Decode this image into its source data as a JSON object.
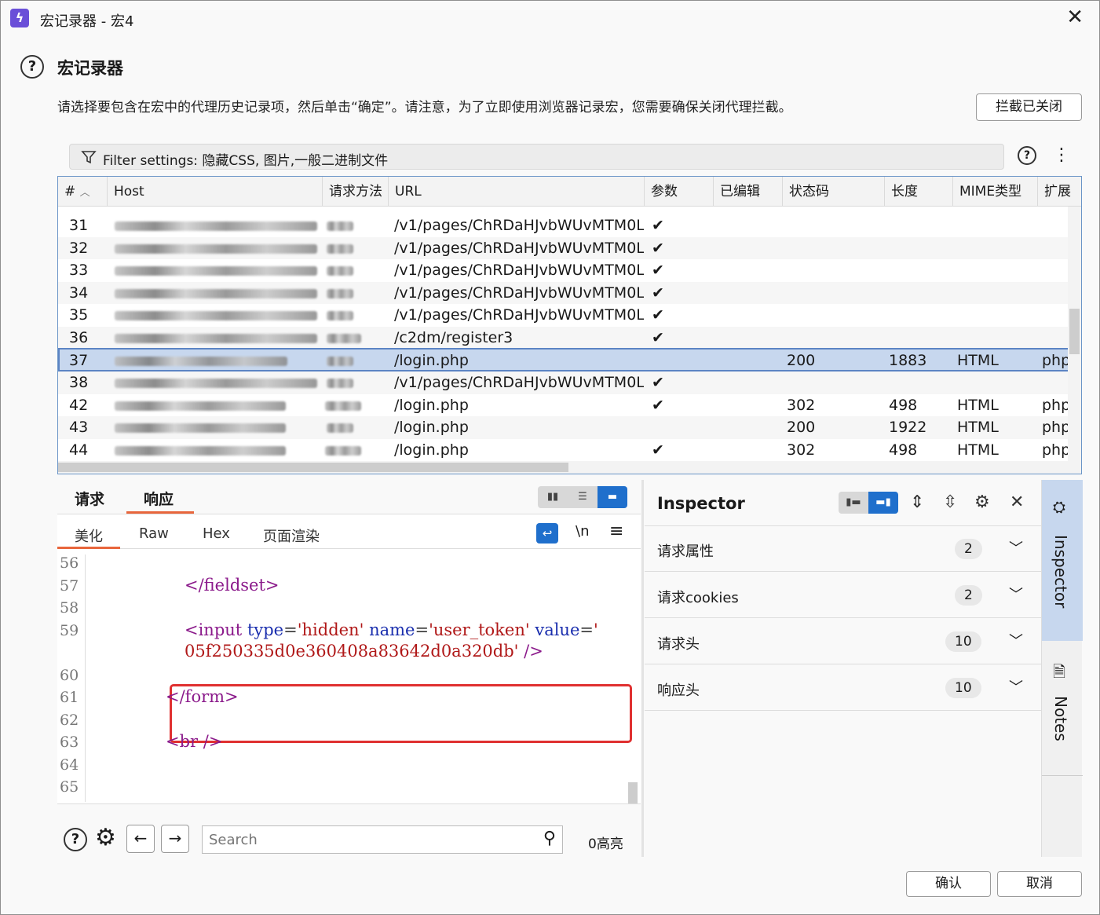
{
  "window": {
    "title": "宏记录器 - 宏4"
  },
  "header": {
    "title": "宏记录器",
    "instructions": "请选择要包含在宏中的代理历史记录项，然后单击“确定”。请注意，为了立即使用浏览器记录宏，您需要确保关闭代理拦截。",
    "intercept_button": "拦截已关闭"
  },
  "filter": {
    "label": "Filter settings: 隐藏CSS, 图片,一般二进制文件"
  },
  "table": {
    "columns": [
      "#",
      "Host",
      "请求方法",
      "URL",
      "参数",
      "已编辑",
      "状态码",
      "长度",
      "MIME类型",
      "扩展"
    ],
    "rows": [
      {
        "num": "31",
        "url": "/v1/pages/ChRDaHJvbWUvMTM0L...",
        "params": "✔",
        "status": "",
        "length": "",
        "mime": "",
        "ext": ""
      },
      {
        "num": "32",
        "url": "/v1/pages/ChRDaHJvbWUvMTM0L...",
        "params": "✔",
        "status": "",
        "length": "",
        "mime": "",
        "ext": ""
      },
      {
        "num": "33",
        "url": "/v1/pages/ChRDaHJvbWUvMTM0L...",
        "params": "✔",
        "status": "",
        "length": "",
        "mime": "",
        "ext": ""
      },
      {
        "num": "34",
        "url": "/v1/pages/ChRDaHJvbWUvMTM0L...",
        "params": "✔",
        "status": "",
        "length": "",
        "mime": "",
        "ext": ""
      },
      {
        "num": "35",
        "url": "/v1/pages/ChRDaHJvbWUvMTM0L...",
        "params": "✔",
        "status": "",
        "length": "",
        "mime": "",
        "ext": ""
      },
      {
        "num": "36",
        "url": "/c2dm/register3",
        "params": "✔",
        "status": "",
        "length": "",
        "mime": "",
        "ext": ""
      },
      {
        "num": "37",
        "url": "/login.php",
        "params": "",
        "status": "200",
        "length": "1883",
        "mime": "HTML",
        "ext": "php"
      },
      {
        "num": "38",
        "url": "/v1/pages/ChRDaHJvbWUvMTM0L...",
        "params": "✔",
        "status": "",
        "length": "",
        "mime": "",
        "ext": ""
      },
      {
        "num": "42",
        "url": "/login.php",
        "params": "✔",
        "status": "302",
        "length": "498",
        "mime": "HTML",
        "ext": "php"
      },
      {
        "num": "43",
        "url": "/login.php",
        "params": "",
        "status": "200",
        "length": "1922",
        "mime": "HTML",
        "ext": "php"
      },
      {
        "num": "44",
        "url": "/login.php",
        "params": "✔",
        "status": "302",
        "length": "498",
        "mime": "HTML",
        "ext": "php"
      }
    ],
    "selected_row": "37"
  },
  "editor": {
    "tabs": [
      "请求",
      "响应"
    ],
    "active_tab": "响应",
    "sub_tabs": [
      "美化",
      "Raw",
      "Hex",
      "页面渲染"
    ],
    "active_sub_tab": "美化",
    "newline_label": "\\n",
    "line_numbers": [
      "56",
      "57",
      "58",
      "59",
      "60",
      "61",
      "62",
      "63",
      "64",
      "65"
    ],
    "code": {
      "l57": "</fieldset>",
      "l59_open": "<input",
      "l59_type_attr": "type",
      "l59_type_val": "'hidden'",
      "l59_name_attr": "name",
      "l59_name_val": "'user_token'",
      "l59_value_attr": "value",
      "l59_value_q": "'",
      "l59b_val": "05f250335d0e360408a83642d0a320db'",
      "l59b_close": "/>",
      "l61": "</form>",
      "l63": "<br />"
    },
    "search_placeholder": "Search",
    "highlight_count": "0高亮"
  },
  "inspector": {
    "title": "Inspector",
    "sections": [
      {
        "label": "请求属性",
        "count": "2"
      },
      {
        "label": "请求cookies",
        "count": "2"
      },
      {
        "label": "请求头",
        "count": "10"
      },
      {
        "label": "响应头",
        "count": "10"
      }
    ]
  },
  "side_rail": {
    "inspector_label": "Inspector",
    "notes_label": "Notes"
  },
  "footer": {
    "ok": "确认",
    "cancel": "取消"
  }
}
